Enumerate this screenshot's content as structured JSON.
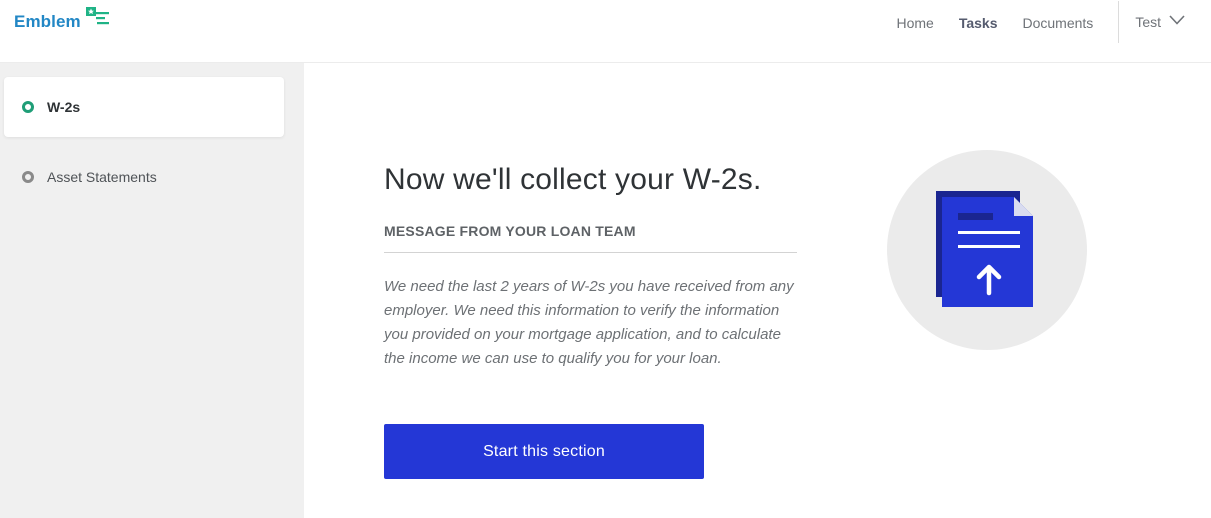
{
  "brand": {
    "name": "Emblem",
    "accent": "#2287c5",
    "mark_color": "#1fb386"
  },
  "nav": {
    "items": [
      {
        "label": "Home",
        "active": false
      },
      {
        "label": "Tasks",
        "active": true
      },
      {
        "label": "Documents",
        "active": false
      }
    ],
    "user": {
      "name": "Test",
      "icon": "chevron-down-icon"
    }
  },
  "sidebar": {
    "items": [
      {
        "label": "W-2s",
        "active": true,
        "status_color": "#1f9e77"
      },
      {
        "label": "Asset Statements",
        "active": false,
        "status_color": "#8a8a8a"
      }
    ]
  },
  "main": {
    "headline": "Now we'll collect your W-2s.",
    "message_label": "MESSAGE FROM YOUR LOAN TEAM",
    "message_body": "We need the last 2 years of W-2s you have received from any employer. We need this information to verify the information you provided on your mortgage application, and to calculate the income we can use to qualify you for your loan.",
    "cta_label": "Start this section",
    "cta_color": "#2437d6",
    "illustration": "document-upload-icon"
  }
}
